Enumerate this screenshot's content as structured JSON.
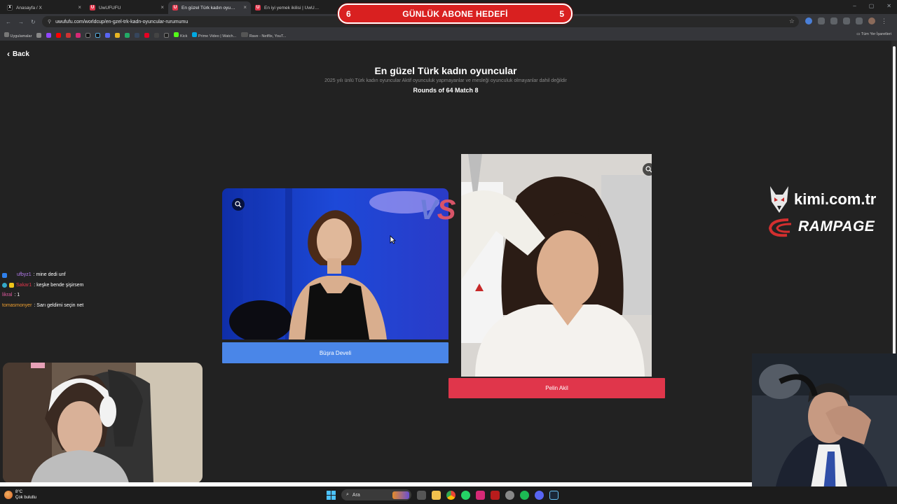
{
  "browser": {
    "tabs": [
      {
        "title": "Anasayfa / X",
        "favicon": "x-favicon",
        "active": false
      },
      {
        "title": "UwUFUFU",
        "favicon": "uwufufu-favicon",
        "active": false
      },
      {
        "title": "En güzel Türk kadın oyuncular |",
        "favicon": "uwufufu-favicon",
        "active": true
      },
      {
        "title": "En iyi yemek ikilisi | UwUFUFU",
        "favicon": "uwufufu-favicon",
        "active": false
      }
    ],
    "url": "uwufufu.com/worldcup/en-gzel-trk-kadn-oyuncular-rurumumu",
    "bookmarks": [
      "Uygulamalar",
      "Kick",
      "Prime Video | Watch...",
      "Rave - Netflix, YouT..."
    ],
    "bookmarks_right": "Tüm Yer İşaretleri"
  },
  "overlay": {
    "goal_left": "6",
    "goal_title": "GÜNLÜK ABONE HEDEFİ",
    "goal_right": "5",
    "sponsor1": "kimi.com.tr",
    "sponsor2": "RAMPAGE"
  },
  "page": {
    "back_label": "Back",
    "title": "En güzel Türk kadın oyuncular",
    "subtitle": "2025 yılı ünlü Türk kadın oyuncular Aktif oyunculuk yapmayanlar ve mesleği oyunculuk olmayanlar dahil değildir",
    "rounds": "Rounds of 64 Match 8",
    "vs_v": "V",
    "vs_s": "S",
    "left_choice": {
      "name": "Büşra Develi",
      "color": "#4a86e8"
    },
    "right_choice": {
      "name": "Pelin Akil",
      "color": "#e0364b"
    }
  },
  "chat": [
    {
      "user": "ufbyz1",
      "message": ": mine dedi unf",
      "user_color": "#b57cf0"
    },
    {
      "user": "Sakar1",
      "message": ": keşke bende şişirsem",
      "user_color": "#e0364b"
    },
    {
      "user": "likral",
      "message": ": 1",
      "user_color": "#e05aa0"
    },
    {
      "user": "tomasmonyer",
      "message": ": Sarı geldimi seçin net",
      "user_color": "#f0a030"
    }
  ],
  "taskbar": {
    "temp": "8°C",
    "weather": "Çok bulutlu",
    "search_placeholder": "Ara"
  }
}
